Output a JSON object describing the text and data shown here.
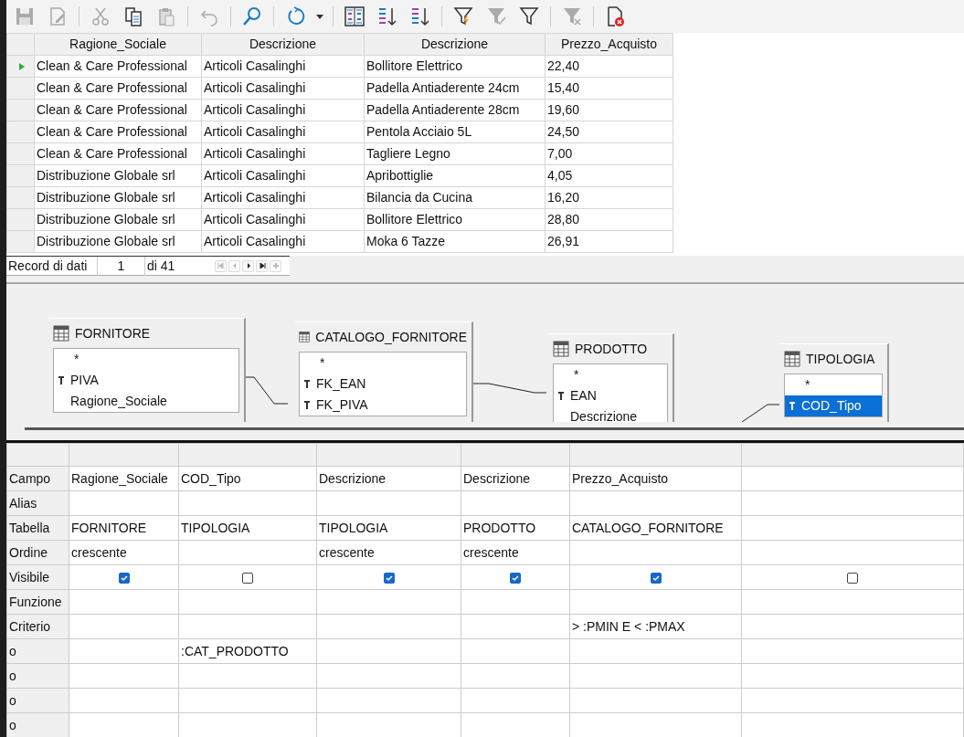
{
  "toolbar": [
    {
      "kind": "save",
      "disabled": true
    },
    {
      "kind": "edit",
      "disabled": true
    },
    {
      "kind": "separator"
    },
    {
      "kind": "cut",
      "disabled": true
    },
    {
      "kind": "copy",
      "disabled": false
    },
    {
      "kind": "paste",
      "disabled": true
    },
    {
      "kind": "separator"
    },
    {
      "kind": "undo",
      "disabled": true
    },
    {
      "kind": "separator"
    },
    {
      "kind": "find",
      "disabled": false
    },
    {
      "kind": "separator"
    },
    {
      "kind": "refresh",
      "disabled": false
    },
    {
      "kind": "dropdown",
      "disabled": false
    },
    {
      "kind": "separator"
    },
    {
      "kind": "sort",
      "disabled": false
    },
    {
      "kind": "sort-asc",
      "disabled": false
    },
    {
      "kind": "sort-desc",
      "disabled": false
    },
    {
      "kind": "separator"
    },
    {
      "kind": "autofilter",
      "disabled": false
    },
    {
      "kind": "apply-filter",
      "disabled": true
    },
    {
      "kind": "standard-filter",
      "disabled": false
    },
    {
      "kind": "separator"
    },
    {
      "kind": "remove-filter",
      "disabled": true
    },
    {
      "kind": "separator"
    },
    {
      "kind": "close-doc",
      "disabled": false
    }
  ],
  "results": {
    "columns": [
      "Ragione_Sociale",
      "Descrizione",
      "Descrizione",
      "Prezzo_Acquisto"
    ],
    "rows": [
      {
        "selected": true,
        "cells": [
          "Clean & Care Professional",
          "Articoli Casalinghi",
          "Bollitore Elettrico",
          "22,40"
        ]
      },
      {
        "selected": false,
        "cells": [
          "Clean & Care Professional",
          "Articoli Casalinghi",
          "Padella Antiaderente 24cm",
          "15,40"
        ]
      },
      {
        "selected": false,
        "cells": [
          "Clean & Care Professional",
          "Articoli Casalinghi",
          "Padella Antiaderente 28cm",
          "19,60"
        ]
      },
      {
        "selected": false,
        "cells": [
          "Clean & Care Professional",
          "Articoli Casalinghi",
          "Pentola Acciaio 5L",
          "24,50"
        ]
      },
      {
        "selected": false,
        "cells": [
          "Clean & Care Professional",
          "Articoli Casalinghi",
          "Tagliere Legno",
          "7,00"
        ]
      },
      {
        "selected": false,
        "cells": [
          "Distribuzione Globale srl",
          "Articoli Casalinghi",
          "Apribottiglie",
          "4,05"
        ]
      },
      {
        "selected": false,
        "cells": [
          "Distribuzione Globale srl",
          "Articoli Casalinghi",
          "Bilancia da Cucina",
          "16,20"
        ]
      },
      {
        "selected": false,
        "cells": [
          "Distribuzione Globale srl",
          "Articoli Casalinghi",
          "Bollitore Elettrico",
          "28,80"
        ]
      },
      {
        "selected": false,
        "cells": [
          "Distribuzione Globale srl",
          "Articoli Casalinghi",
          "Moka 6 Tazze",
          "26,91"
        ]
      }
    ]
  },
  "record_bar": {
    "label": "Record di dati",
    "current": "1",
    "total": "di 41",
    "nav": [
      {
        "kind": "first",
        "disabled": true
      },
      {
        "kind": "prev",
        "disabled": true
      },
      {
        "kind": "next",
        "disabled": false
      },
      {
        "kind": "last",
        "disabled": false
      },
      {
        "kind": "new",
        "disabled": true
      }
    ]
  },
  "design_tables": [
    {
      "name": "FORNITORE",
      "fields": [
        {
          "name": "*",
          "key": false,
          "selected": false
        },
        {
          "name": "PIVA",
          "key": true,
          "selected": false
        },
        {
          "name": "Ragione_Sociale",
          "key": false,
          "selected": false
        }
      ]
    },
    {
      "name": "CATALOGO_FORNITORE",
      "fields": [
        {
          "name": "*",
          "key": false,
          "selected": false
        },
        {
          "name": "FK_EAN",
          "key": true,
          "selected": false
        },
        {
          "name": "FK_PIVA",
          "key": true,
          "selected": false
        }
      ]
    },
    {
      "name": "PRODOTTO",
      "fields": [
        {
          "name": "*",
          "key": false,
          "selected": false
        },
        {
          "name": "EAN",
          "key": true,
          "selected": false
        },
        {
          "name": "Descrizione",
          "key": false,
          "selected": false
        }
      ]
    },
    {
      "name": "TIPOLOGIA",
      "fields": [
        {
          "name": "*",
          "key": false,
          "selected": false
        },
        {
          "name": "COD_Tipo",
          "key": true,
          "selected": true
        }
      ]
    }
  ],
  "query_rows": [
    {
      "label": "Campo",
      "kind": "text"
    },
    {
      "label": "Alias",
      "kind": "text"
    },
    {
      "label": "Tabella",
      "kind": "text"
    },
    {
      "label": "Ordine",
      "kind": "text"
    },
    {
      "label": "Visibile",
      "kind": "check"
    },
    {
      "label": "Funzione",
      "kind": "text"
    },
    {
      "label": "Criterio",
      "kind": "text"
    },
    {
      "label": "o",
      "kind": "text"
    },
    {
      "label": "o",
      "kind": "text"
    },
    {
      "label": "o",
      "kind": "text"
    },
    {
      "label": "o",
      "kind": "text"
    }
  ],
  "query_columns": [
    {
      "campo": "Ragione_Sociale",
      "tabella": "FORNITORE",
      "ordine": "crescente",
      "visibile": true
    },
    {
      "campo": "COD_Tipo",
      "tabella": "TIPOLOGIA",
      "visibile": false,
      "o1": ":CAT_PRODOTTO"
    },
    {
      "campo": "Descrizione",
      "tabella": "TIPOLOGIA",
      "ordine": "crescente",
      "visibile": true
    },
    {
      "campo": "Descrizione",
      "tabella": "PRODOTTO",
      "ordine": "crescente",
      "visibile": true
    },
    {
      "campo": "Prezzo_Acquisto",
      "tabella": "CATALOGO_FORNITORE",
      "visibile": true,
      "criterio": "> :PMIN E < :PMAX"
    },
    {
      "visibile": false
    }
  ]
}
